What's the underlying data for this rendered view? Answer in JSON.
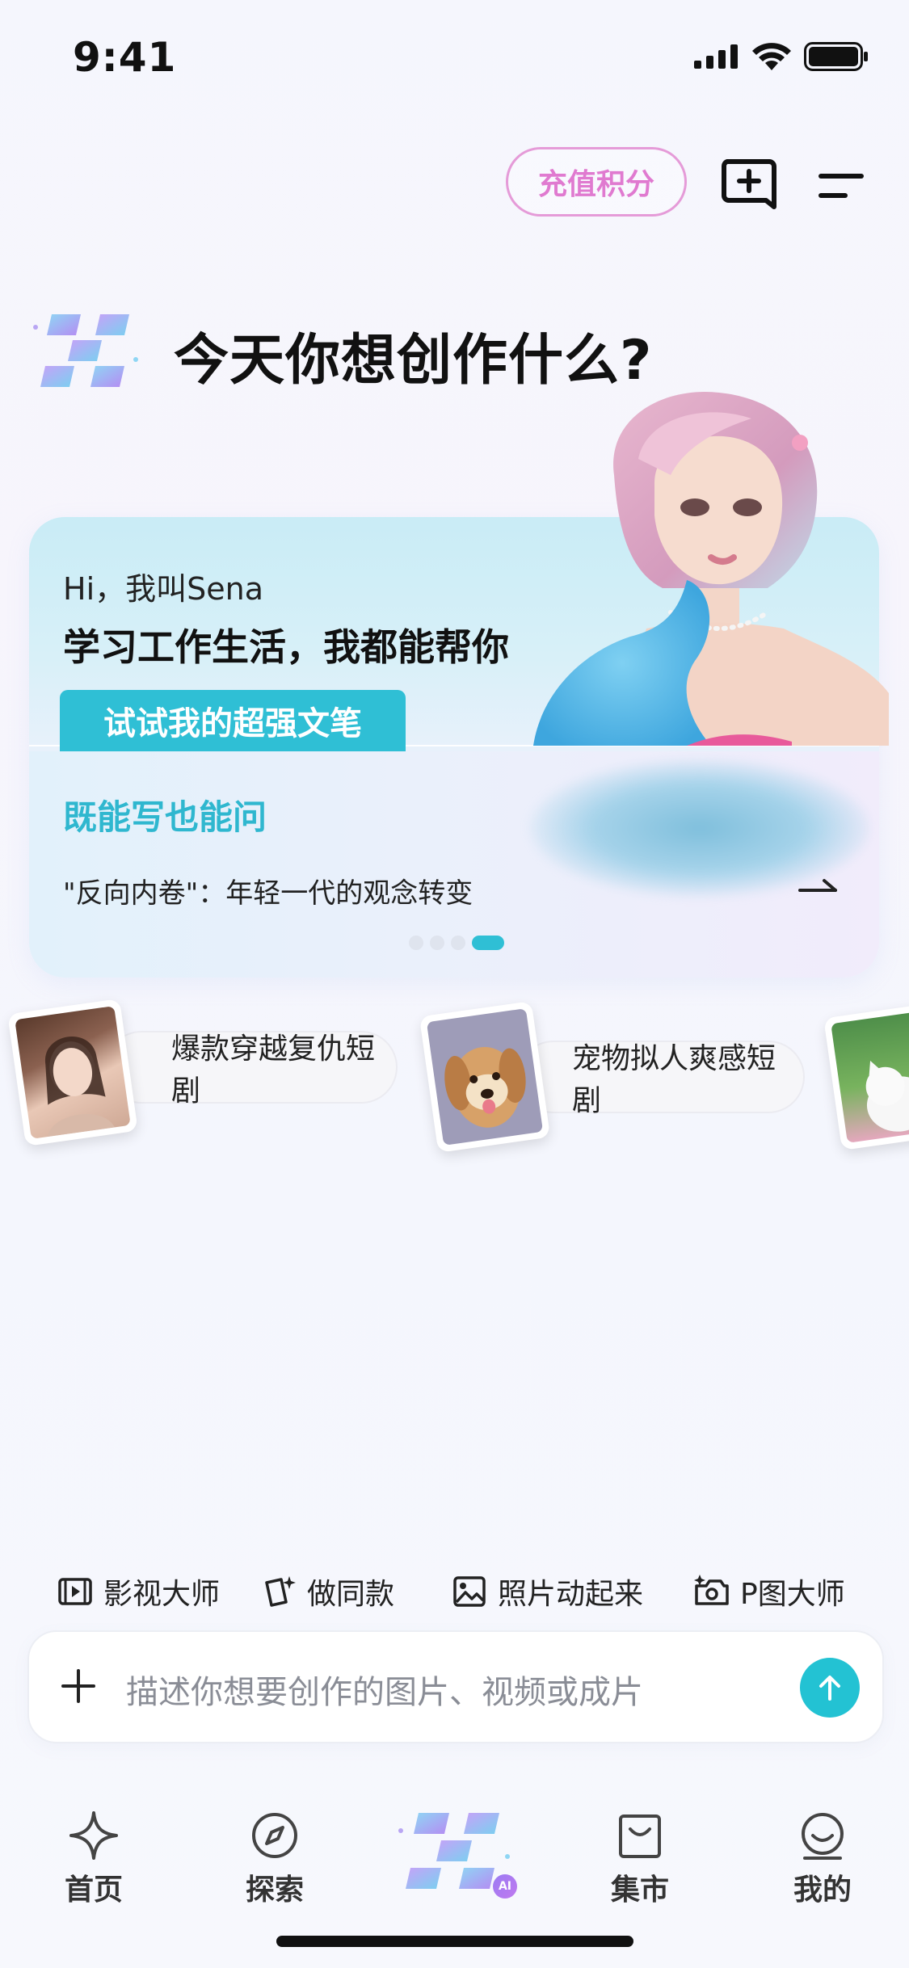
{
  "status_bar": {
    "time": "9:41"
  },
  "header": {
    "recharge_label": "充值积分"
  },
  "hero": {
    "title": "今天你想创作什么?"
  },
  "card": {
    "greeting": "Hi，我叫Sena",
    "subtitle": "学习工作生活，我都能帮你",
    "button_label": "试试我的超强文笔",
    "section_title": "既能写也能问",
    "topic_line": "\"反向内卷\"：年轻一代的观念转变",
    "carousel": {
      "total": 4,
      "active_index": 3
    }
  },
  "suggestions": [
    {
      "label": "爆款穿越复仇短剧"
    },
    {
      "label": "宠物拟人爽感短剧"
    }
  ],
  "tools": [
    {
      "label": "影视大师",
      "icon": "film-icon"
    },
    {
      "label": "做同款",
      "icon": "sparkle-card-icon"
    },
    {
      "label": "照片动起来",
      "icon": "image-icon"
    },
    {
      "label": "P图大师",
      "icon": "photo-edit-icon"
    }
  ],
  "composer": {
    "placeholder": "描述你想要创作的图片、视频或成片"
  },
  "tabbar": {
    "items": [
      {
        "label": "首页",
        "icon": "star-icon"
      },
      {
        "label": "探索",
        "icon": "compass-icon"
      },
      {
        "label": "",
        "icon": "ai-logo-icon",
        "badge": "AI"
      },
      {
        "label": "集市",
        "icon": "shopping-bag-icon"
      },
      {
        "label": "我的",
        "icon": "smile-icon"
      }
    ]
  },
  "colors": {
    "accent_cyan": "#2fbfd5",
    "recharge_pink": "#e07ad0",
    "send_button": "#23c2d3"
  }
}
